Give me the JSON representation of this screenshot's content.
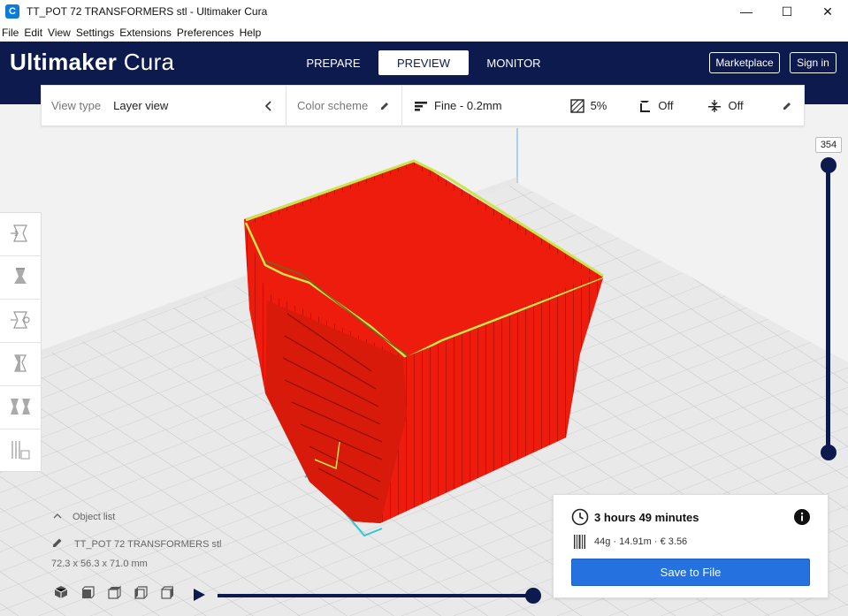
{
  "window": {
    "title": "TT_POT 72 TRANSFORMERS stl - Ultimaker Cura",
    "app_icon_letter": "C",
    "minimize": "—",
    "maximize": "☐",
    "close": "✕"
  },
  "menu": [
    "File",
    "Edit",
    "View",
    "Settings",
    "Extensions",
    "Preferences",
    "Help"
  ],
  "header": {
    "brand_bold": "Ultimaker",
    "brand_light": "Cura",
    "tabs": [
      {
        "label": "PREPARE"
      },
      {
        "label": "PREVIEW"
      },
      {
        "label": "MONITOR"
      }
    ],
    "marketplace_label": "Marketplace",
    "signin_label": "Sign in"
  },
  "settings_bar": {
    "view_type_label": "View type",
    "view_type_value": "Layer view",
    "color_scheme_label": "Color scheme",
    "profile": "Fine - 0.2mm",
    "infill": "5%",
    "support": "Off",
    "adhesion": "Off"
  },
  "layer_slider": {
    "current_layer": "354"
  },
  "object_list": {
    "toggle_label": "Object list",
    "name": "TT_POT 72 TRANSFORMERS stl",
    "dimensions": "72.3 x 56.3 x 71.0 mm"
  },
  "print_info": {
    "time": "3 hours 49 minutes",
    "material": "44g · 14.91m · € 3.56",
    "save_label": "Save to File"
  },
  "colors": {
    "header": "#0d1a4d",
    "model": "#ee1c0c",
    "accent": "#2671e0"
  },
  "icons": [
    "cura-logo-icon",
    "view-type-chevron-icon",
    "pencil-icon",
    "profile-icon",
    "infill-icon",
    "support-icon",
    "adhesion-icon",
    "clock-icon",
    "info-icon",
    "material-icon",
    "play-icon",
    "move-tool-icon",
    "scale-tool-icon",
    "rotate-tool-icon",
    "mirror-tool-icon",
    "per-model-settings-icon",
    "support-blocker-icon"
  ]
}
